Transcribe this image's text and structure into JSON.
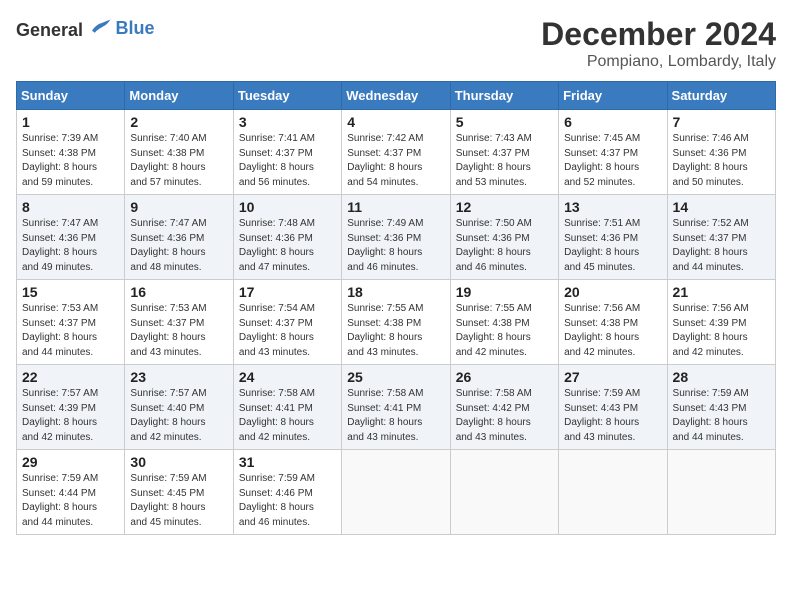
{
  "header": {
    "logo_general": "General",
    "logo_blue": "Blue",
    "month_title": "December 2024",
    "location": "Pompiano, Lombardy, Italy"
  },
  "days_of_week": [
    "Sunday",
    "Monday",
    "Tuesday",
    "Wednesday",
    "Thursday",
    "Friday",
    "Saturday"
  ],
  "weeks": [
    [
      {
        "day": "1",
        "sunrise": "7:39 AM",
        "sunset": "4:38 PM",
        "daylight_hours": "8",
        "daylight_minutes": "59"
      },
      {
        "day": "2",
        "sunrise": "7:40 AM",
        "sunset": "4:38 PM",
        "daylight_hours": "8",
        "daylight_minutes": "57"
      },
      {
        "day": "3",
        "sunrise": "7:41 AM",
        "sunset": "4:37 PM",
        "daylight_hours": "8",
        "daylight_minutes": "56"
      },
      {
        "day": "4",
        "sunrise": "7:42 AM",
        "sunset": "4:37 PM",
        "daylight_hours": "8",
        "daylight_minutes": "54"
      },
      {
        "day": "5",
        "sunrise": "7:43 AM",
        "sunset": "4:37 PM",
        "daylight_hours": "8",
        "daylight_minutes": "53"
      },
      {
        "day": "6",
        "sunrise": "7:45 AM",
        "sunset": "4:37 PM",
        "daylight_hours": "8",
        "daylight_minutes": "52"
      },
      {
        "day": "7",
        "sunrise": "7:46 AM",
        "sunset": "4:36 PM",
        "daylight_hours": "8",
        "daylight_minutes": "50"
      }
    ],
    [
      {
        "day": "8",
        "sunrise": "7:47 AM",
        "sunset": "4:36 PM",
        "daylight_hours": "8",
        "daylight_minutes": "49"
      },
      {
        "day": "9",
        "sunrise": "7:47 AM",
        "sunset": "4:36 PM",
        "daylight_hours": "8",
        "daylight_minutes": "48"
      },
      {
        "day": "10",
        "sunrise": "7:48 AM",
        "sunset": "4:36 PM",
        "daylight_hours": "8",
        "daylight_minutes": "47"
      },
      {
        "day": "11",
        "sunrise": "7:49 AM",
        "sunset": "4:36 PM",
        "daylight_hours": "8",
        "daylight_minutes": "46"
      },
      {
        "day": "12",
        "sunrise": "7:50 AM",
        "sunset": "4:36 PM",
        "daylight_hours": "8",
        "daylight_minutes": "46"
      },
      {
        "day": "13",
        "sunrise": "7:51 AM",
        "sunset": "4:36 PM",
        "daylight_hours": "8",
        "daylight_minutes": "45"
      },
      {
        "day": "14",
        "sunrise": "7:52 AM",
        "sunset": "4:37 PM",
        "daylight_hours": "8",
        "daylight_minutes": "44"
      }
    ],
    [
      {
        "day": "15",
        "sunrise": "7:53 AM",
        "sunset": "4:37 PM",
        "daylight_hours": "8",
        "daylight_minutes": "44"
      },
      {
        "day": "16",
        "sunrise": "7:53 AM",
        "sunset": "4:37 PM",
        "daylight_hours": "8",
        "daylight_minutes": "43"
      },
      {
        "day": "17",
        "sunrise": "7:54 AM",
        "sunset": "4:37 PM",
        "daylight_hours": "8",
        "daylight_minutes": "43"
      },
      {
        "day": "18",
        "sunrise": "7:55 AM",
        "sunset": "4:38 PM",
        "daylight_hours": "8",
        "daylight_minutes": "43"
      },
      {
        "day": "19",
        "sunrise": "7:55 AM",
        "sunset": "4:38 PM",
        "daylight_hours": "8",
        "daylight_minutes": "42"
      },
      {
        "day": "20",
        "sunrise": "7:56 AM",
        "sunset": "4:38 PM",
        "daylight_hours": "8",
        "daylight_minutes": "42"
      },
      {
        "day": "21",
        "sunrise": "7:56 AM",
        "sunset": "4:39 PM",
        "daylight_hours": "8",
        "daylight_minutes": "42"
      }
    ],
    [
      {
        "day": "22",
        "sunrise": "7:57 AM",
        "sunset": "4:39 PM",
        "daylight_hours": "8",
        "daylight_minutes": "42"
      },
      {
        "day": "23",
        "sunrise": "7:57 AM",
        "sunset": "4:40 PM",
        "daylight_hours": "8",
        "daylight_minutes": "42"
      },
      {
        "day": "24",
        "sunrise": "7:58 AM",
        "sunset": "4:41 PM",
        "daylight_hours": "8",
        "daylight_minutes": "42"
      },
      {
        "day": "25",
        "sunrise": "7:58 AM",
        "sunset": "4:41 PM",
        "daylight_hours": "8",
        "daylight_minutes": "43"
      },
      {
        "day": "26",
        "sunrise": "7:58 AM",
        "sunset": "4:42 PM",
        "daylight_hours": "8",
        "daylight_minutes": "43"
      },
      {
        "day": "27",
        "sunrise": "7:59 AM",
        "sunset": "4:43 PM",
        "daylight_hours": "8",
        "daylight_minutes": "43"
      },
      {
        "day": "28",
        "sunrise": "7:59 AM",
        "sunset": "4:43 PM",
        "daylight_hours": "8",
        "daylight_minutes": "44"
      }
    ],
    [
      {
        "day": "29",
        "sunrise": "7:59 AM",
        "sunset": "4:44 PM",
        "daylight_hours": "8",
        "daylight_minutes": "44"
      },
      {
        "day": "30",
        "sunrise": "7:59 AM",
        "sunset": "4:45 PM",
        "daylight_hours": "8",
        "daylight_minutes": "45"
      },
      {
        "day": "31",
        "sunrise": "7:59 AM",
        "sunset": "4:46 PM",
        "daylight_hours": "8",
        "daylight_minutes": "46"
      },
      null,
      null,
      null,
      null
    ]
  ]
}
